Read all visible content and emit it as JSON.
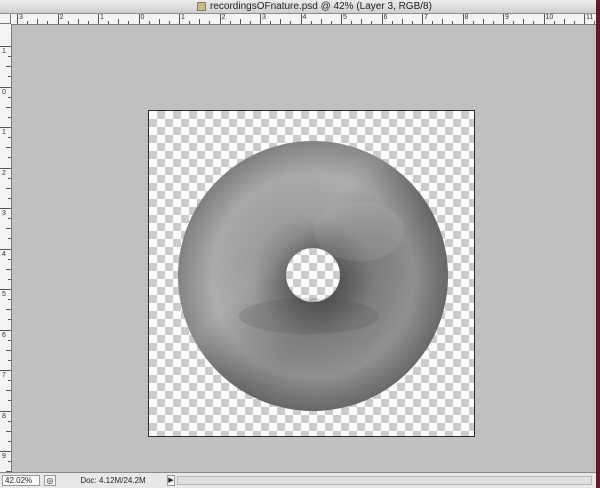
{
  "window": {
    "title": "recordingsOFnature.psd @ 42% (Layer 3, RGB/8)",
    "icon": "psd-document-icon"
  },
  "rulers": {
    "horizontal_labels": [
      "3",
      "2",
      "1",
      "0",
      "1",
      "2",
      "3",
      "4",
      "5",
      "6",
      "7",
      "8",
      "9",
      "10",
      "11"
    ],
    "vertical_labels": [
      "1",
      "0",
      "1",
      "2",
      "3",
      "4",
      "5",
      "6",
      "7",
      "8",
      "9"
    ]
  },
  "canvas": {
    "content": "gray-donut-disc",
    "background": "transparency-checkerboard"
  },
  "status": {
    "zoom": "42.02%",
    "doc_size": "Doc: 4.12M/24.2M",
    "preview_icon": "preview-icon",
    "menu_arrow": "▶"
  },
  "colors": {
    "workspace": "#c0c0c0",
    "desktop": "#5b1d2c"
  }
}
